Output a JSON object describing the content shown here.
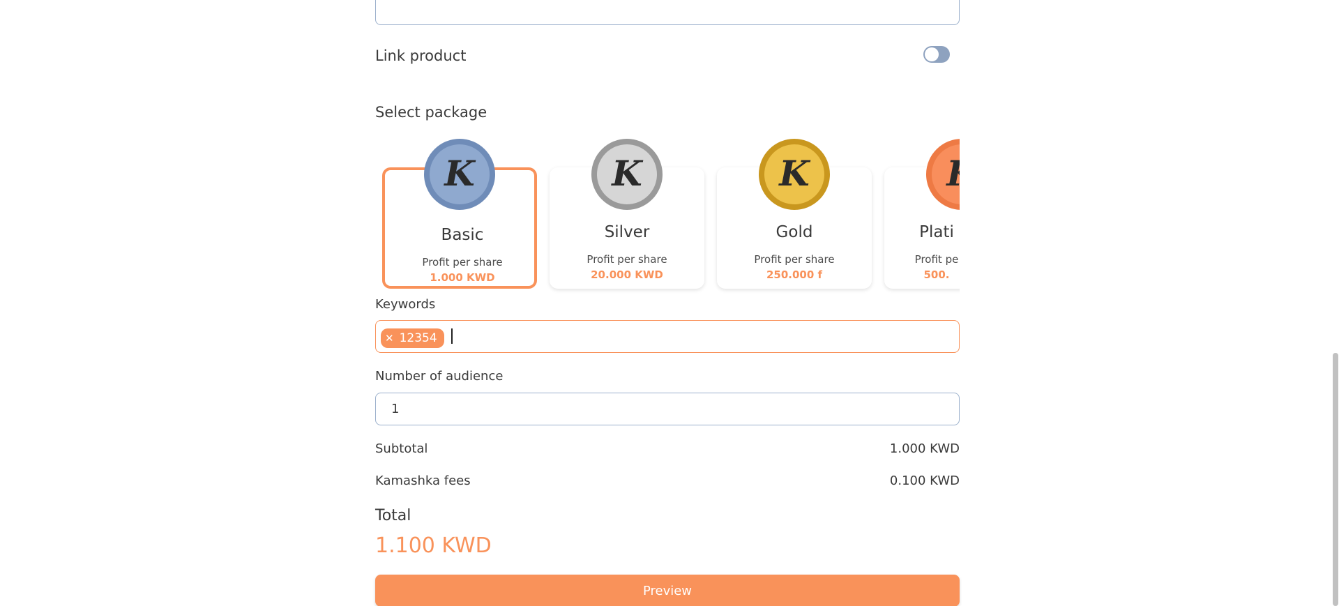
{
  "link_product": {
    "label": "Link product",
    "enabled": false
  },
  "select_package": {
    "title": "Select package",
    "packages": [
      {
        "name": "Basic",
        "profit_label": "Profit per share",
        "value": "1.000 KWD",
        "selected": true,
        "coin_letter": "K",
        "coin_color": "#8fa9cf"
      },
      {
        "name": "Silver",
        "profit_label": "Profit per share",
        "value": "20.000 KWD",
        "selected": false,
        "coin_letter": "K",
        "coin_color": "#c9c9c9"
      },
      {
        "name": "Gold",
        "profit_label": "Profit per share",
        "value": "250.000 f",
        "selected": false,
        "coin_letter": "K",
        "coin_color": "#e6b83a"
      },
      {
        "name": "Plati",
        "profit_label": "Profit pe",
        "value": "500.",
        "selected": false,
        "coin_letter": "K",
        "coin_color": "#f98e5c"
      }
    ]
  },
  "keywords": {
    "label": "Keywords",
    "chips": [
      "12354"
    ],
    "value": ""
  },
  "audience": {
    "label": "Number of audience",
    "value": "1"
  },
  "summary": {
    "subtotal_label": "Subtotal",
    "subtotal_value": "1.000 KWD",
    "fees_label": "Kamashka fees",
    "fees_value": "0.100 KWD",
    "total_label": "Total",
    "total_value": "1.100 KWD"
  },
  "actions": {
    "preview_label": "Preview"
  },
  "colors": {
    "accent": "#f9925a",
    "border": "#9bb0cc",
    "toggle_off": "#8ea2bf"
  }
}
